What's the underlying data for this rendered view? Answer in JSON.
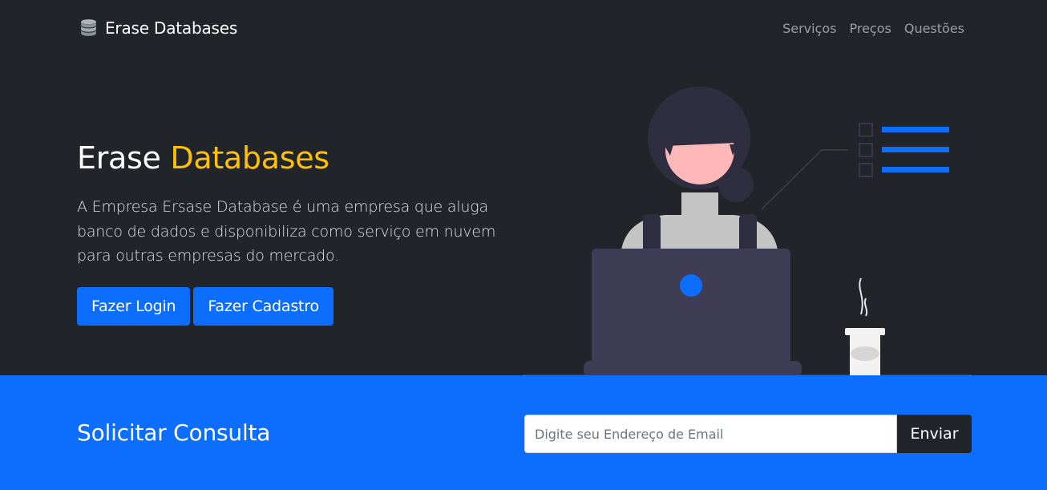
{
  "navbar": {
    "brand_icon": "database-icon",
    "brand_text": "Erase Databases",
    "links": [
      "Serviços",
      "Preços",
      "Questões"
    ]
  },
  "hero": {
    "title_main": "Erase",
    "title_accent": "Databases",
    "description": "A Empresa Ersase Database é uma empresa que aluga banco de dados e disponibiliza como serviço em nuvem para outras empresas do mercado.",
    "login_button": "Fazer Login",
    "signup_button": "Fazer Cadastro"
  },
  "cta": {
    "title": "Solicitar Consulta",
    "email_placeholder": "Digite seu Endereço de Email",
    "email_value": "",
    "send_button": "Enviar"
  },
  "colors": {
    "dark": "#212529",
    "primary": "#0d6efd",
    "accent": "#ffc107"
  }
}
